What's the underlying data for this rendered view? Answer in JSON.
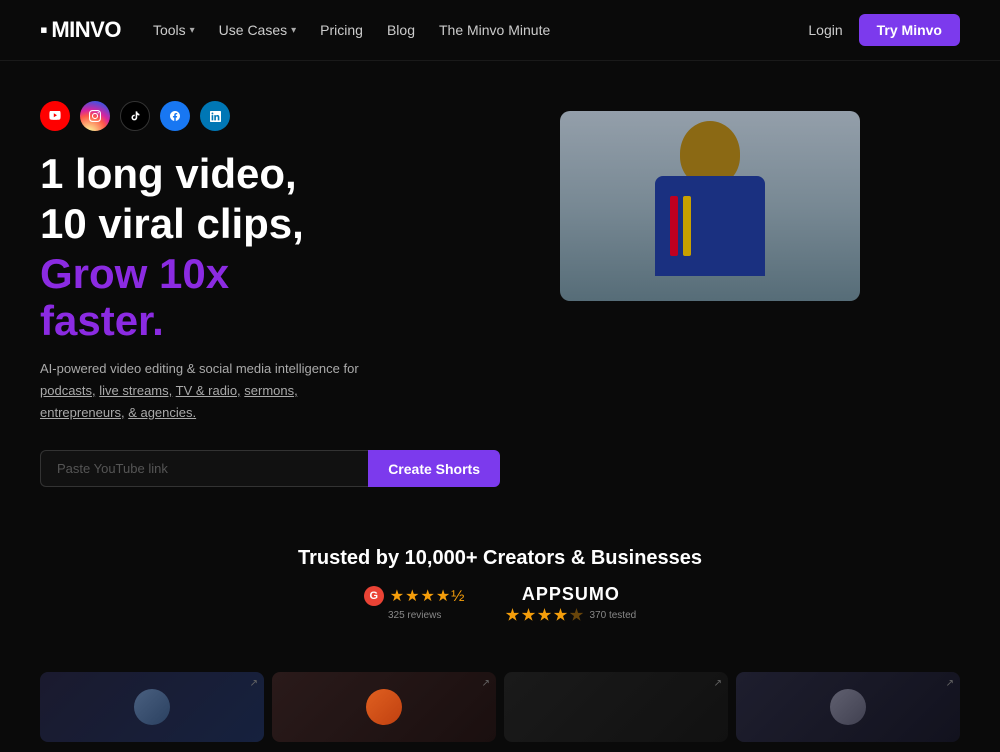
{
  "nav": {
    "logo": "MINVO",
    "links": [
      {
        "label": "Tools",
        "hasDropdown": true
      },
      {
        "label": "Use Cases",
        "hasDropdown": true
      },
      {
        "label": "Pricing",
        "hasDropdown": false
      },
      {
        "label": "Blog",
        "hasDropdown": false
      },
      {
        "label": "The Minvo Minute",
        "hasDropdown": false
      }
    ],
    "login_label": "Login",
    "try_label": "Try Minvo"
  },
  "social": {
    "icons": [
      {
        "name": "youtube",
        "label": "YouTube"
      },
      {
        "name": "instagram",
        "label": "Instagram"
      },
      {
        "name": "tiktok",
        "label": "TikTok"
      },
      {
        "name": "facebook",
        "label": "Facebook"
      },
      {
        "name": "linkedin",
        "label": "LinkedIn"
      }
    ]
  },
  "hero": {
    "line1": "1 long video,",
    "line2": "10 viral clips,",
    "line3": "Grow 10x",
    "line4": "faster.",
    "subtext": "AI-powered video editing & social media intelligence for",
    "links": [
      "podcasts,",
      "live streams,",
      "TV & radio,",
      "sermons,",
      "entrepreneurs,",
      "& agencies."
    ],
    "input_placeholder": "Paste YouTube link",
    "cta_button": "Create Shorts"
  },
  "trusted": {
    "title": "Trusted by 10,000+ Creators & Businesses",
    "google": {
      "label": "G",
      "stars": "★★★★½",
      "count": "325 reviews"
    },
    "appsumo": {
      "label": "APPSUMO",
      "count": "370 tested"
    }
  },
  "cards": [
    {
      "id": "card1",
      "type": "avatar"
    },
    {
      "id": "card2",
      "type": "avatar"
    },
    {
      "id": "card3",
      "type": "avatar"
    },
    {
      "id": "card4",
      "type": "avatar"
    }
  ]
}
